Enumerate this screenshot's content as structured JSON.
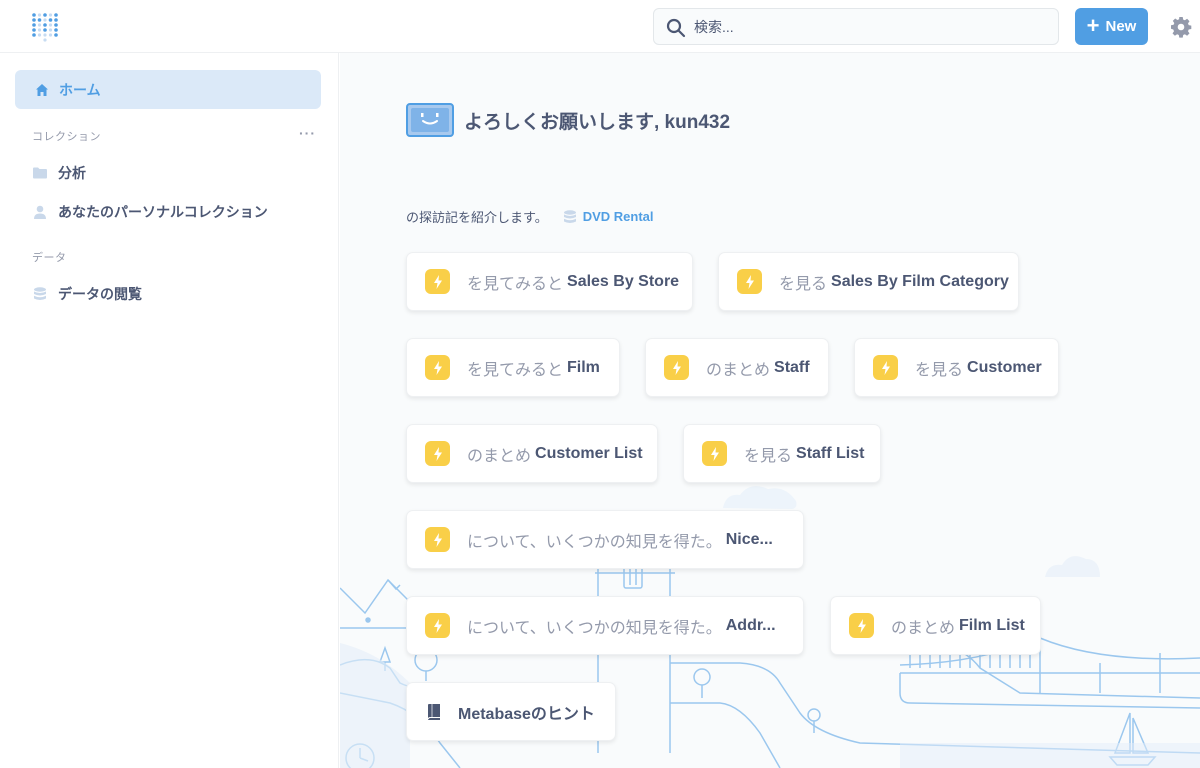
{
  "topbar": {
    "search_placeholder": "検索...",
    "new_label": "New"
  },
  "sidebar": {
    "home_label": "ホーム",
    "collections_header": "コレクション",
    "more_label": "···",
    "collections": [
      {
        "label": "分析",
        "icon": "folder-icon"
      },
      {
        "label": "あなたのパーソナルコレクション",
        "icon": "person-icon"
      }
    ],
    "data_header": "データ",
    "data_items": [
      {
        "label": "データの閲覧",
        "icon": "database-icon"
      }
    ]
  },
  "main": {
    "greeting": "よろしくお願いします, kun432",
    "intro_text": "の探訪記を紹介します。",
    "database_name": "DVD Rental",
    "cards": [
      {
        "pre": "を見てみると",
        "target": "Sales By Store"
      },
      {
        "pre": "を見る",
        "target": "Sales By Film Category"
      },
      {
        "pre": "を見てみると",
        "target": "Film"
      },
      {
        "pre": "のまとめ",
        "target": "Staff"
      },
      {
        "pre": "を見る",
        "target": "Customer"
      },
      {
        "pre": "のまとめ",
        "target": "Customer List"
      },
      {
        "pre": "を見る",
        "target": "Staff List"
      },
      {
        "pre": "について、いくつかの知見を得た。",
        "target": "Nice..."
      },
      {
        "pre": "について、いくつかの知見を得た。",
        "target": "Addr..."
      },
      {
        "pre": "のまとめ",
        "target": "Film List"
      }
    ],
    "hint_label": "Metabaseのヒント"
  },
  "colors": {
    "brand": "#509ee3",
    "home_bg": "#dbe9f8",
    "bolt": "#f9cf48",
    "text": "#4c5773",
    "muted": "#949aab"
  }
}
